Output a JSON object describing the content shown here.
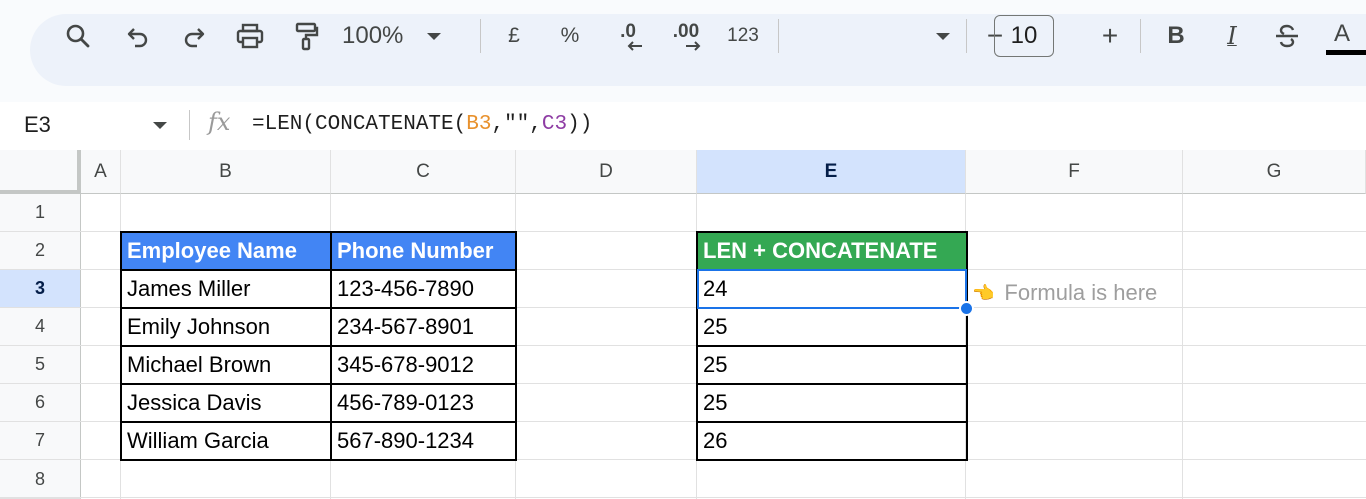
{
  "toolbar": {
    "zoom": "100%",
    "currency": "£",
    "percent": "%",
    "decrease_decimal": ".0",
    "increase_decimal": ".00",
    "number_format": "123",
    "font_size": "10",
    "minus": "−",
    "plus": "+",
    "bold": "B",
    "italic": "I",
    "text_color": "A"
  },
  "formula_bar": {
    "cell_ref": "E3",
    "fx": "fx",
    "formula_prefix": "=LEN(CONCATENATE(",
    "formula_ref1": "B3",
    "formula_mid": ",\"\",",
    "formula_ref2": "C3",
    "formula_suffix": "))"
  },
  "grid": {
    "columns": [
      "A",
      "B",
      "C",
      "D",
      "E",
      "F",
      "G"
    ],
    "rows": [
      "1",
      "2",
      "3",
      "4",
      "5",
      "6",
      "7",
      "8"
    ],
    "selected_column": "E",
    "selected_row": "3"
  },
  "table": {
    "headers": [
      "Employee Name",
      "Phone Number"
    ],
    "rows": [
      [
        "James Miller",
        "123-456-7890"
      ],
      [
        "Emily Johnson",
        "234-567-8901"
      ],
      [
        "Michael Brown",
        "345-678-9012"
      ],
      [
        "Jessica Davis",
        "456-789-0123"
      ],
      [
        "William Garcia",
        "567-890-1234"
      ]
    ]
  },
  "result": {
    "header": "LEN + CONCATENATE",
    "values": [
      "24",
      "25",
      "25",
      "25",
      "26"
    ]
  },
  "hint": {
    "pointer": "👈",
    "text": "Formula is here"
  },
  "colors": {
    "header_blue": "#4285f4",
    "header_green": "#34a853",
    "selection": "#1a73e8",
    "selected_header": "#d3e3fd"
  }
}
